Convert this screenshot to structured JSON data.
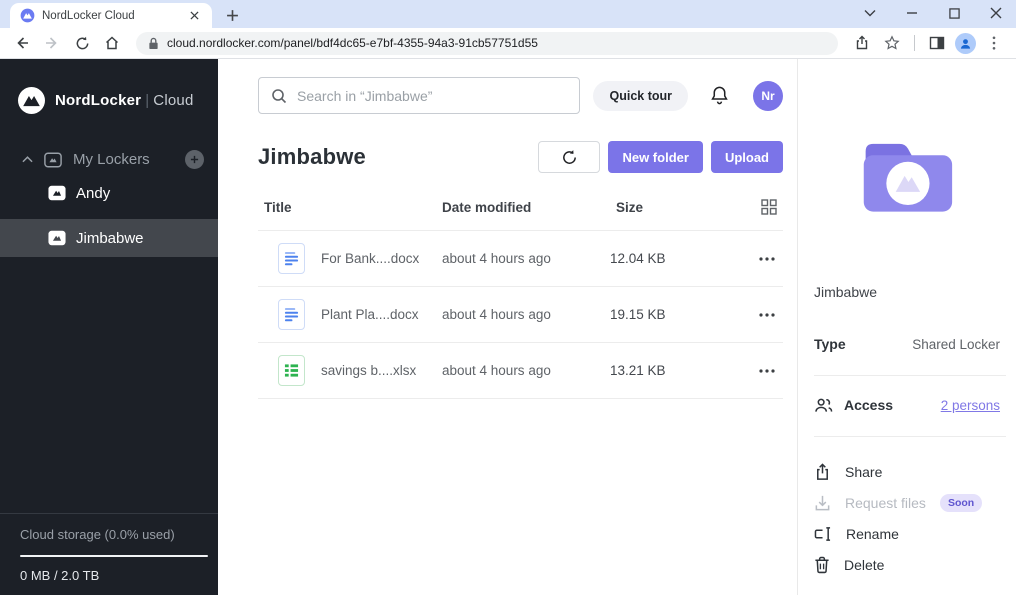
{
  "browser": {
    "tab_title": "NordLocker Cloud",
    "url": "cloud.nordlocker.com/panel/bdf4dc65-e7bf-4355-94a3-91cb57751d55"
  },
  "sidebar": {
    "brand": "NordLocker",
    "brand_divider": "|",
    "brand_suffix": "Cloud",
    "my_lockers_label": "My Lockers",
    "lockers": [
      {
        "name": "Andy"
      },
      {
        "name": "Jimbabwe"
      }
    ],
    "storage_label": "Cloud storage (0.0% used)",
    "storage_usage": "0 MB / 2.0 TB"
  },
  "header": {
    "search_placeholder": "Search in “Jimbabwe”",
    "quick_tour_label": "Quick tour",
    "avatar_initials": "Nr"
  },
  "content": {
    "title": "Jimbabwe",
    "new_folder_label": "New folder",
    "upload_label": "Upload",
    "table": {
      "headers": {
        "title": "Title",
        "date": "Date modified",
        "size": "Size"
      },
      "rows": [
        {
          "name": "For Bank....docx",
          "date": "about 4 hours ago",
          "size": "12.04 KB",
          "type": "docx"
        },
        {
          "name": "Plant Pla....docx",
          "date": "about 4 hours ago",
          "size": "19.15 KB",
          "type": "docx"
        },
        {
          "name": "savings b....xlsx",
          "date": "about 4 hours ago",
          "size": "13.21 KB",
          "type": "xlsx"
        }
      ]
    }
  },
  "details": {
    "name": "Jimbabwe",
    "type_label": "Type",
    "type_value": "Shared Locker",
    "access_label": "Access",
    "access_link": "2 persons",
    "actions": {
      "share": "Share",
      "request_files": "Request files",
      "request_files_badge": "Soon",
      "rename": "Rename",
      "delete": "Delete"
    }
  },
  "colors": {
    "accent_purple": "#7b74e8",
    "sidebar_bg": "#1c2027",
    "selected_item_bg": "#43474d",
    "link_purple": "#8078e6",
    "tabstrip_bg": "#d8e3f8"
  }
}
